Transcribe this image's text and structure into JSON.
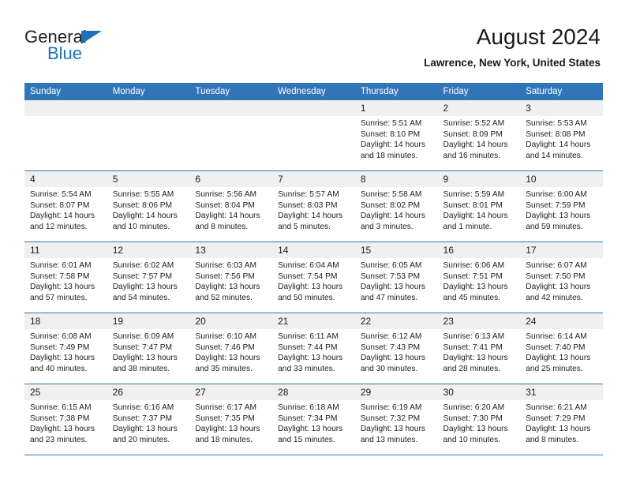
{
  "brand": {
    "name_top": "General",
    "name_bottom": "Blue"
  },
  "header": {
    "title": "August 2024",
    "location": "Lawrence, New York, United States"
  },
  "calendar": {
    "weekday_headers": [
      "Sunday",
      "Monday",
      "Tuesday",
      "Wednesday",
      "Thursday",
      "Friday",
      "Saturday"
    ],
    "colors": {
      "header_blue": "#3175b8",
      "daynum_gray": "#f0f0f0",
      "logo_blue": "#1d71b8"
    },
    "weeks": [
      [
        {
          "day": "",
          "empty": true
        },
        {
          "day": "",
          "empty": true
        },
        {
          "day": "",
          "empty": true
        },
        {
          "day": "",
          "empty": true
        },
        {
          "day": "1",
          "sunrise": "Sunrise: 5:51 AM",
          "sunset": "Sunset: 8:10 PM",
          "daylight": "Daylight: 14 hours and 18 minutes."
        },
        {
          "day": "2",
          "sunrise": "Sunrise: 5:52 AM",
          "sunset": "Sunset: 8:09 PM",
          "daylight": "Daylight: 14 hours and 16 minutes."
        },
        {
          "day": "3",
          "sunrise": "Sunrise: 5:53 AM",
          "sunset": "Sunset: 8:08 PM",
          "daylight": "Daylight: 14 hours and 14 minutes."
        }
      ],
      [
        {
          "day": "4",
          "sunrise": "Sunrise: 5:54 AM",
          "sunset": "Sunset: 8:07 PM",
          "daylight": "Daylight: 14 hours and 12 minutes."
        },
        {
          "day": "5",
          "sunrise": "Sunrise: 5:55 AM",
          "sunset": "Sunset: 8:06 PM",
          "daylight": "Daylight: 14 hours and 10 minutes."
        },
        {
          "day": "6",
          "sunrise": "Sunrise: 5:56 AM",
          "sunset": "Sunset: 8:04 PM",
          "daylight": "Daylight: 14 hours and 8 minutes."
        },
        {
          "day": "7",
          "sunrise": "Sunrise: 5:57 AM",
          "sunset": "Sunset: 8:03 PM",
          "daylight": "Daylight: 14 hours and 5 minutes."
        },
        {
          "day": "8",
          "sunrise": "Sunrise: 5:58 AM",
          "sunset": "Sunset: 8:02 PM",
          "daylight": "Daylight: 14 hours and 3 minutes."
        },
        {
          "day": "9",
          "sunrise": "Sunrise: 5:59 AM",
          "sunset": "Sunset: 8:01 PM",
          "daylight": "Daylight: 14 hours and 1 minute."
        },
        {
          "day": "10",
          "sunrise": "Sunrise: 6:00 AM",
          "sunset": "Sunset: 7:59 PM",
          "daylight": "Daylight: 13 hours and 59 minutes."
        }
      ],
      [
        {
          "day": "11",
          "sunrise": "Sunrise: 6:01 AM",
          "sunset": "Sunset: 7:58 PM",
          "daylight": "Daylight: 13 hours and 57 minutes."
        },
        {
          "day": "12",
          "sunrise": "Sunrise: 6:02 AM",
          "sunset": "Sunset: 7:57 PM",
          "daylight": "Daylight: 13 hours and 54 minutes."
        },
        {
          "day": "13",
          "sunrise": "Sunrise: 6:03 AM",
          "sunset": "Sunset: 7:56 PM",
          "daylight": "Daylight: 13 hours and 52 minutes."
        },
        {
          "day": "14",
          "sunrise": "Sunrise: 6:04 AM",
          "sunset": "Sunset: 7:54 PM",
          "daylight": "Daylight: 13 hours and 50 minutes."
        },
        {
          "day": "15",
          "sunrise": "Sunrise: 6:05 AM",
          "sunset": "Sunset: 7:53 PM",
          "daylight": "Daylight: 13 hours and 47 minutes."
        },
        {
          "day": "16",
          "sunrise": "Sunrise: 6:06 AM",
          "sunset": "Sunset: 7:51 PM",
          "daylight": "Daylight: 13 hours and 45 minutes."
        },
        {
          "day": "17",
          "sunrise": "Sunrise: 6:07 AM",
          "sunset": "Sunset: 7:50 PM",
          "daylight": "Daylight: 13 hours and 42 minutes."
        }
      ],
      [
        {
          "day": "18",
          "sunrise": "Sunrise: 6:08 AM",
          "sunset": "Sunset: 7:49 PM",
          "daylight": "Daylight: 13 hours and 40 minutes."
        },
        {
          "day": "19",
          "sunrise": "Sunrise: 6:09 AM",
          "sunset": "Sunset: 7:47 PM",
          "daylight": "Daylight: 13 hours and 38 minutes."
        },
        {
          "day": "20",
          "sunrise": "Sunrise: 6:10 AM",
          "sunset": "Sunset: 7:46 PM",
          "daylight": "Daylight: 13 hours and 35 minutes."
        },
        {
          "day": "21",
          "sunrise": "Sunrise: 6:11 AM",
          "sunset": "Sunset: 7:44 PM",
          "daylight": "Daylight: 13 hours and 33 minutes."
        },
        {
          "day": "22",
          "sunrise": "Sunrise: 6:12 AM",
          "sunset": "Sunset: 7:43 PM",
          "daylight": "Daylight: 13 hours and 30 minutes."
        },
        {
          "day": "23",
          "sunrise": "Sunrise: 6:13 AM",
          "sunset": "Sunset: 7:41 PM",
          "daylight": "Daylight: 13 hours and 28 minutes."
        },
        {
          "day": "24",
          "sunrise": "Sunrise: 6:14 AM",
          "sunset": "Sunset: 7:40 PM",
          "daylight": "Daylight: 13 hours and 25 minutes."
        }
      ],
      [
        {
          "day": "25",
          "sunrise": "Sunrise: 6:15 AM",
          "sunset": "Sunset: 7:38 PM",
          "daylight": "Daylight: 13 hours and 23 minutes."
        },
        {
          "day": "26",
          "sunrise": "Sunrise: 6:16 AM",
          "sunset": "Sunset: 7:37 PM",
          "daylight": "Daylight: 13 hours and 20 minutes."
        },
        {
          "day": "27",
          "sunrise": "Sunrise: 6:17 AM",
          "sunset": "Sunset: 7:35 PM",
          "daylight": "Daylight: 13 hours and 18 minutes."
        },
        {
          "day": "28",
          "sunrise": "Sunrise: 6:18 AM",
          "sunset": "Sunset: 7:34 PM",
          "daylight": "Daylight: 13 hours and 15 minutes."
        },
        {
          "day": "29",
          "sunrise": "Sunrise: 6:19 AM",
          "sunset": "Sunset: 7:32 PM",
          "daylight": "Daylight: 13 hours and 13 minutes."
        },
        {
          "day": "30",
          "sunrise": "Sunrise: 6:20 AM",
          "sunset": "Sunset: 7:30 PM",
          "daylight": "Daylight: 13 hours and 10 minutes."
        },
        {
          "day": "31",
          "sunrise": "Sunrise: 6:21 AM",
          "sunset": "Sunset: 7:29 PM",
          "daylight": "Daylight: 13 hours and 8 minutes."
        }
      ]
    ]
  }
}
